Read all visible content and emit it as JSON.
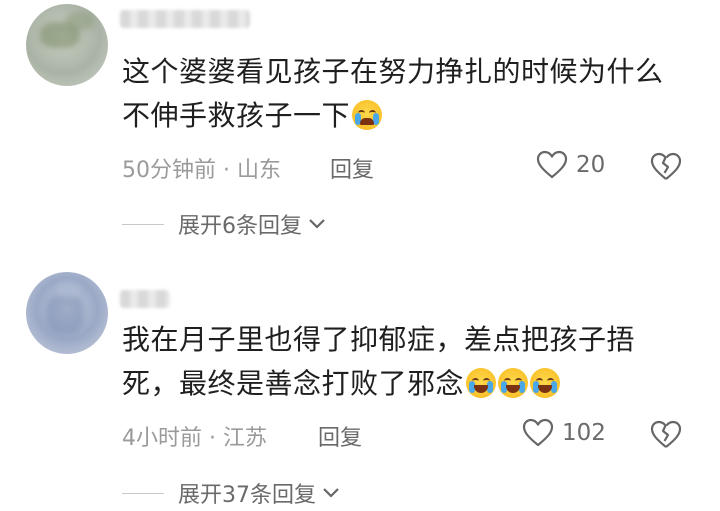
{
  "comments": [
    {
      "text": "这个婆婆看见孩子在努力挣扎的时候为什么不伸手救孩子一下",
      "emoji": "loudly-crying-face-icon",
      "time_location": "50分钟前 · 山东",
      "reply_label": "回复",
      "likes": "20",
      "expand_label": "展开6条回复"
    },
    {
      "text": "我在月子里也得了抑郁症，差点把孩子捂死，最终是善念打败了邪念",
      "emoji": "rolling-laughing-face-icon",
      "time_location": "4小时前 · 江苏",
      "reply_label": "回复",
      "likes": "102",
      "expand_label": "展开37条回复"
    }
  ]
}
